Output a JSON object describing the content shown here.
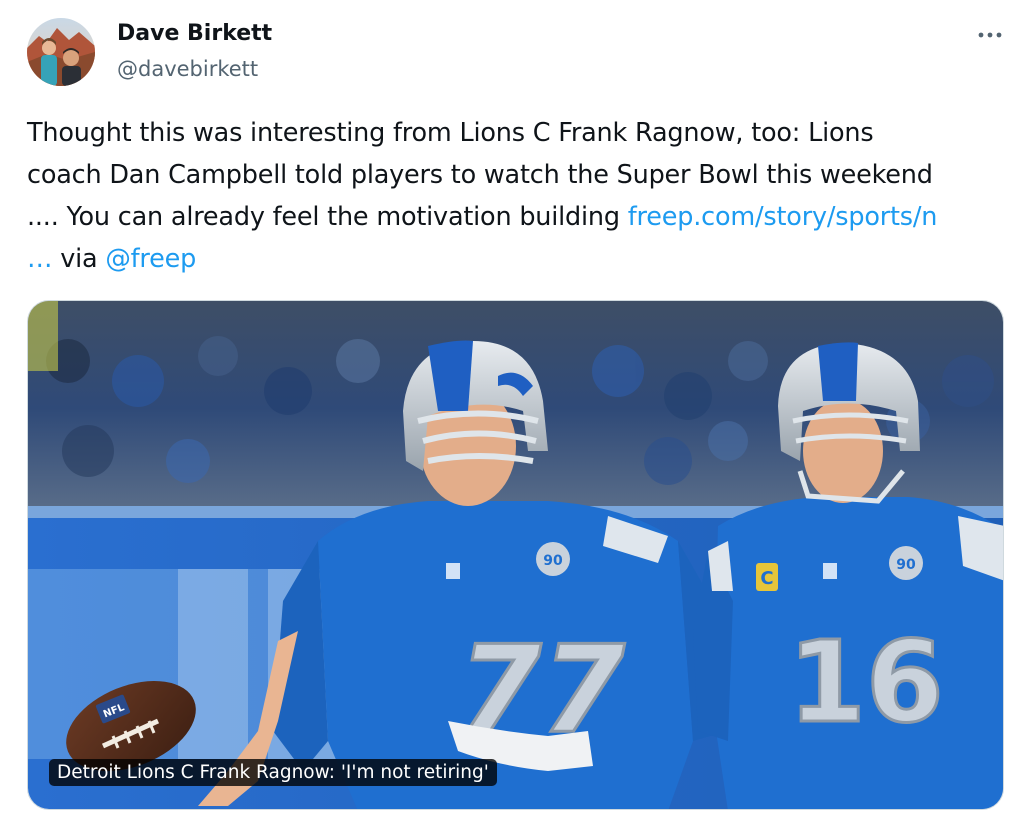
{
  "author": {
    "name": "Dave Birkett",
    "handle": "@davebirkett",
    "avatar_icon": "profile-photo"
  },
  "more_icon": "more-horizontal-icon",
  "tweet": {
    "line1": "Thought this was interesting from Lions C Frank Ragnow, too: Lions",
    "line2": "coach Dan Campbell told players to watch the Super Bowl this weekend",
    "line3_text": ".... You can already feel the motivation building ",
    "link_text": "freep.com/story/sports/n",
    "link_ellipsis": "…",
    "via_text": " via ",
    "mention": "@freep"
  },
  "card": {
    "caption": "Detroit Lions C Frank Ragnow: 'I'm not retiring'",
    "image_icon": "football-players-photo",
    "jersey_left": "77",
    "jersey_right": "16",
    "ball_label": "NFL"
  },
  "colors": {
    "link": "#1d9bf0",
    "text": "#0f1419",
    "secondary": "#536471",
    "lions_blue": "#1f6fd0"
  }
}
